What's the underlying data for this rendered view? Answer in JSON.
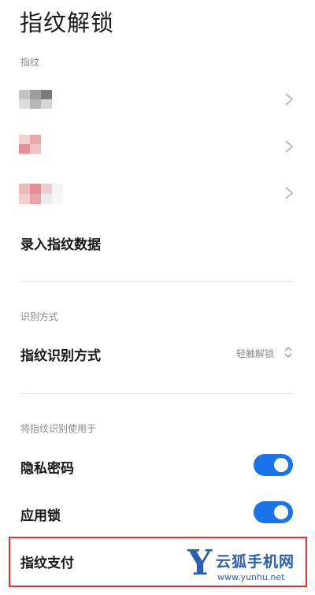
{
  "page": {
    "title": "指纹解锁"
  },
  "fingerprints": {
    "section_label": "指纹",
    "items": [
      {
        "label": "",
        "icon": "chevron-right-icon"
      },
      {
        "label": "",
        "icon": "chevron-right-icon"
      },
      {
        "label": "",
        "icon": "chevron-right-icon"
      }
    ],
    "enroll_label": "录入指纹数据"
  },
  "recognition": {
    "section_label": "识别方式",
    "item_label": "指纹识别方式",
    "item_value": "轻触解锁",
    "icon": "up-down-chevron-icon"
  },
  "usage": {
    "section_label": "将指纹识别使用于",
    "items": [
      {
        "label": "隐私密码",
        "enabled": true
      },
      {
        "label": "应用锁",
        "enabled": true
      },
      {
        "label": "指纹支付"
      }
    ]
  },
  "watermark": {
    "name": "云狐手机网",
    "url": "www.yunhu.net"
  },
  "colors": {
    "accent": "#1a73e8",
    "highlight": "#d23a3a",
    "watermark": "#2d5fb0"
  }
}
